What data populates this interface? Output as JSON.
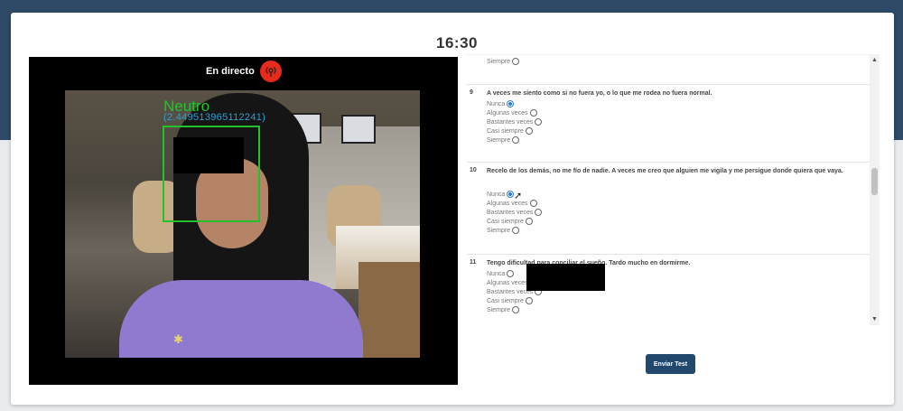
{
  "timer": {
    "value": "16:30"
  },
  "camera": {
    "live_label": "En directo",
    "emotion_label": "Neutro",
    "emotion_score": "(2.449513965112241)"
  },
  "questionnaire": {
    "items": [
      {
        "number": "",
        "text": "",
        "options": [
          {
            "label": "Siempre",
            "checked": false
          }
        ]
      },
      {
        "number": "9",
        "text": "A veces me siento como si no fuera yo, o lo que me rodea no fuera normal.",
        "options": [
          {
            "label": "Nunca",
            "checked": true
          },
          {
            "label": "Algunas veces",
            "checked": false
          },
          {
            "label": "Bastantes veces",
            "checked": false
          },
          {
            "label": "Casi siempre",
            "checked": false
          },
          {
            "label": "Siempre",
            "checked": false
          }
        ]
      },
      {
        "number": "10",
        "text": "Recelo de los demás, no me fío de nadie. A veces me creo que alguien me vigila y me persigue donde quiera que vaya.",
        "options": [
          {
            "label": "Nunca",
            "checked": true
          },
          {
            "label": "Algunas veces",
            "checked": false
          },
          {
            "label": "Bastantes veces",
            "checked": false
          },
          {
            "label": "Casi siempre",
            "checked": false
          },
          {
            "label": "Siempre",
            "checked": false
          }
        ]
      },
      {
        "number": "11",
        "text": "Tengo dificultad para conciliar el sueño. Tardo mucho en dormirme.",
        "options": [
          {
            "label": "Nunca",
            "checked": false
          },
          {
            "label": "Algunas veces",
            "checked": false
          },
          {
            "label": "Bastantes veces",
            "checked": false
          },
          {
            "label": "Casi siempre",
            "checked": false
          },
          {
            "label": "Siempre",
            "checked": false
          }
        ]
      }
    ]
  },
  "submit": {
    "label": "Enviar Test"
  },
  "colors": {
    "header": "#2e4a66",
    "button": "#23486e",
    "detection_box": "#23c22d",
    "live_badge": "#e62a1c"
  }
}
